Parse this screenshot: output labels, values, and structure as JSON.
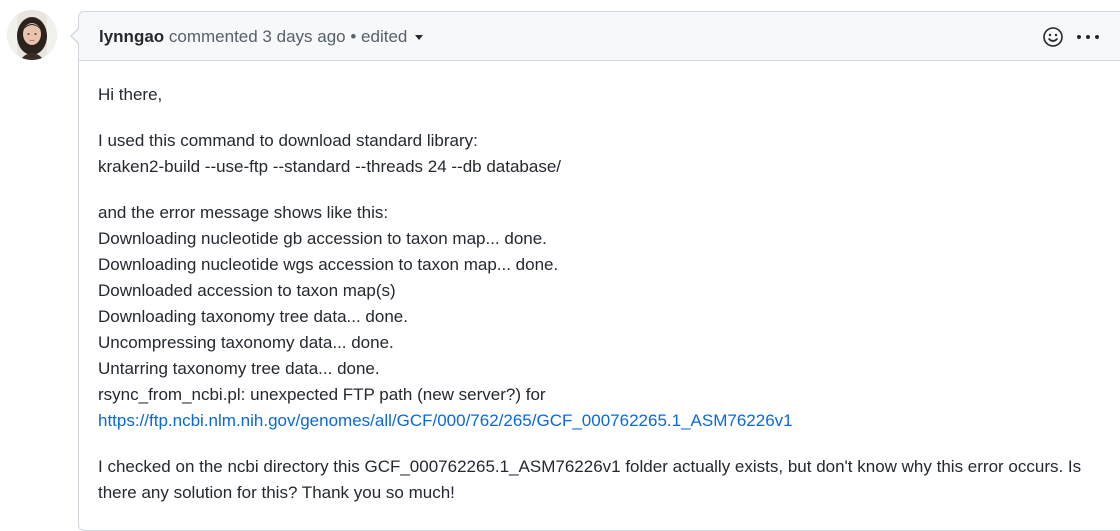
{
  "comment": {
    "author": "lynngao",
    "action_text": " commented 3 days ago",
    "separator": " • ",
    "edited_label": "edited",
    "body": {
      "greeting": "Hi there,",
      "command_intro": "I used this command to download standard library:",
      "command": "kraken2-build --use-ftp --standard --threads 24 --db database/",
      "error_intro": "and the error message shows like this:",
      "error_lines": [
        "Downloading nucleotide gb accession to taxon map... done.",
        "Downloading nucleotide wgs accession to taxon map... done.",
        "Downloaded accession to taxon map(s)",
        "Downloading taxonomy tree data... done.",
        "Uncompressing taxonomy data... done.",
        "Untarring taxonomy tree data... done.",
        "rsync_from_ncbi.pl: unexpected FTP path (new server?) for"
      ],
      "link_text": "https://ftp.ncbi.nlm.nih.gov/genomes/all/GCF/000/762/265/GCF_000762265.1_ASM76226v1",
      "closing": "I checked on the ncbi directory this GCF_000762265.1_ASM76226v1 folder actually exists, but don't know why this error occurs. Is there any solution for this? Thank you so much!"
    }
  },
  "icons": {
    "emoji": "smiley-icon",
    "more": "kebab-horizontal-icon",
    "edited_dropdown": "triangle-down-icon"
  },
  "colors": {
    "border": "#d0d7de",
    "header_bg": "#f6f8fa",
    "text": "#24292f",
    "muted": "#57606a",
    "link": "#0969da"
  }
}
